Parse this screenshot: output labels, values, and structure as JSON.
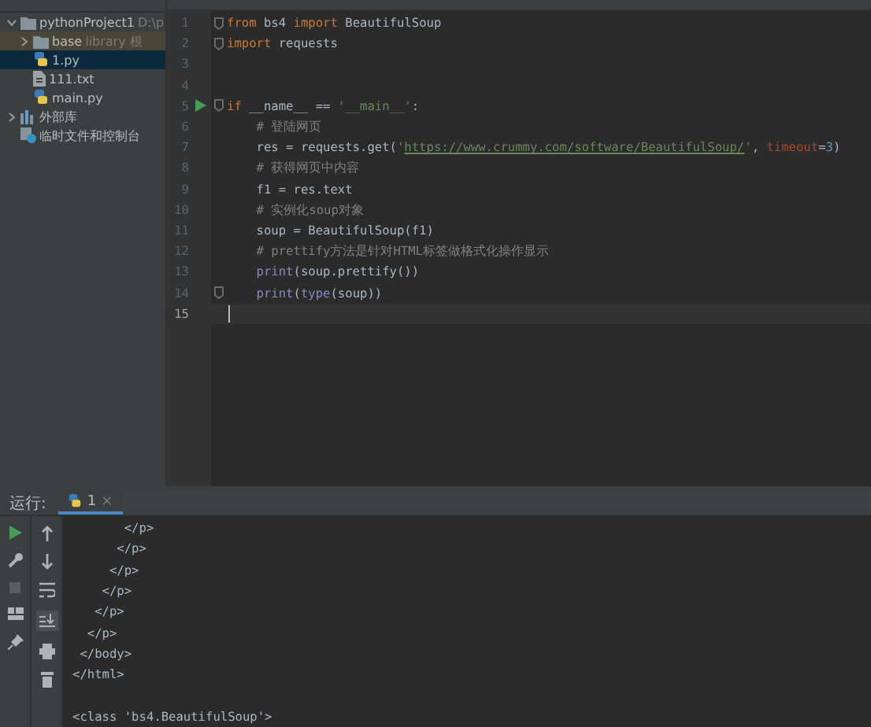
{
  "project_tree": [
    {
      "label": "pythonProject1",
      "hint": "D:\\p",
      "kind": "folder",
      "expanded": true,
      "selected": false,
      "children": [
        {
          "label": "base",
          "hint": "library 根",
          "kind": "folder",
          "expanded": false,
          "selected": false,
          "excluded": true
        },
        {
          "label": "1.py",
          "kind": "python",
          "selected": true
        },
        {
          "label": "111.txt",
          "kind": "text",
          "selected": false
        },
        {
          "label": "main.py",
          "kind": "python",
          "selected": false
        }
      ]
    },
    {
      "label": "外部库",
      "kind": "library",
      "expanded": false,
      "selected": false
    },
    {
      "label": "临时文件和控制台",
      "kind": "scratch",
      "selected": false
    }
  ],
  "editor": {
    "lines": [
      {
        "number": "1",
        "fold": true,
        "tokens": [
          {
            "text": "from",
            "kind": "keyword"
          },
          {
            "text": " bs4 ",
            "kind": "plain"
          },
          {
            "text": "import",
            "kind": "keyword"
          },
          {
            "text": " BeautifulSoup",
            "kind": "plain"
          }
        ]
      },
      {
        "number": "2",
        "fold": true,
        "tokens": [
          {
            "text": "import",
            "kind": "keyword"
          },
          {
            "text": " requests",
            "kind": "plain"
          }
        ]
      },
      {
        "number": "3"
      },
      {
        "number": "4"
      },
      {
        "number": "5",
        "fold": true,
        "run": true,
        "tokens": [
          {
            "text": "if",
            "kind": "keyword"
          },
          {
            "text": " __name__ == ",
            "kind": "plain"
          },
          {
            "text": "'__main__'",
            "kind": "string"
          },
          {
            "text": ":",
            "kind": "plain"
          }
        ]
      },
      {
        "number": "6",
        "tokens": [
          {
            "text": "    # 登陆网页",
            "kind": "comment"
          }
        ]
      },
      {
        "number": "7",
        "tokens": [
          {
            "text": "    res = requests.get(",
            "kind": "plain"
          },
          {
            "text": "'",
            "kind": "string"
          },
          {
            "text": "https://www.crummy.com/software/BeautifulSoup/",
            "kind": "link"
          },
          {
            "text": "'",
            "kind": "string"
          },
          {
            "text": ", ",
            "kind": "plain"
          },
          {
            "text": "timeout",
            "kind": "param"
          },
          {
            "text": "=",
            "kind": "plain"
          },
          {
            "text": "3",
            "kind": "number"
          },
          {
            "text": ")",
            "kind": "plain"
          }
        ]
      },
      {
        "number": "8",
        "tokens": [
          {
            "text": "    # 获得网页中内容",
            "kind": "comment"
          }
        ]
      },
      {
        "number": "9",
        "tokens": [
          {
            "text": "    f1 = res.text",
            "kind": "plain"
          }
        ]
      },
      {
        "number": "10",
        "tokens": [
          {
            "text": "    # 实例化soup对象",
            "kind": "comment"
          }
        ]
      },
      {
        "number": "11",
        "tokens": [
          {
            "text": "    soup = BeautifulSoup(f1)",
            "kind": "plain"
          }
        ]
      },
      {
        "number": "12",
        "tokens": [
          {
            "text": "    # prettify方法是针对HTML标签做格式化操作显示",
            "kind": "comment"
          }
        ]
      },
      {
        "number": "13",
        "tokens": [
          {
            "text": "    print",
            "kind": "builtin"
          },
          {
            "text": "(soup.prettify())",
            "kind": "plain"
          }
        ]
      },
      {
        "number": "14",
        "fold": true,
        "tokens": [
          {
            "text": "    print",
            "kind": "builtin"
          },
          {
            "text": "(",
            "kind": "plain"
          },
          {
            "text": "type",
            "kind": "builtin"
          },
          {
            "text": "(soup))",
            "kind": "plain"
          }
        ]
      },
      {
        "number": "15",
        "current": true
      }
    ]
  },
  "run_panel": {
    "label": "运行:",
    "tab": {
      "label": "1",
      "close": "×",
      "selected": true
    },
    "output": [
      {
        "text": "       </p>"
      },
      {
        "text": "      </p>"
      },
      {
        "text": "     </p>"
      },
      {
        "text": "    </p>"
      },
      {
        "text": "   </p>"
      },
      {
        "text": "  </p>"
      },
      {
        "text": " </body>"
      },
      {
        "text": "</html>"
      },
      {
        "text": "<class 'bs4.BeautifulSoup'>",
        "gap_before": true
      }
    ]
  }
}
